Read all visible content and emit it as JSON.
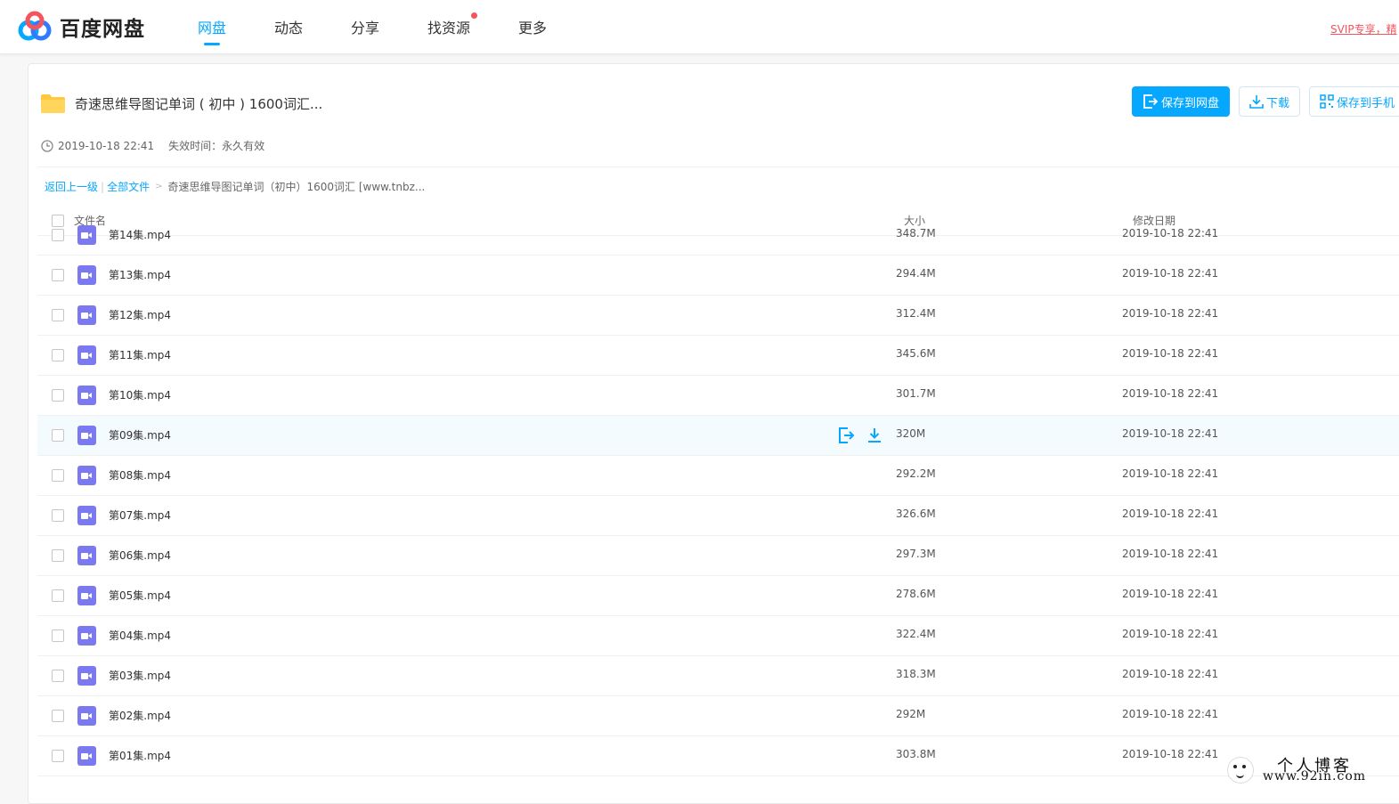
{
  "app": {
    "name": "百度网盘"
  },
  "nav": {
    "items": [
      {
        "label": "网盘",
        "active": true
      },
      {
        "label": "动态",
        "active": false
      },
      {
        "label": "分享",
        "active": false
      },
      {
        "label": "找资源",
        "active": false,
        "badge": true
      },
      {
        "label": "更多",
        "active": false
      }
    ],
    "svip_link": "SVIP专享，精"
  },
  "share": {
    "title": "奇速思维导图记单词 ( 初中 ) 1600词汇...",
    "created": "2019-10-18 22:41",
    "expire_label": "失效时间：",
    "expire_value": "永久有效",
    "folder_icon": "folder-icon",
    "actions": {
      "save_label": "保存到网盘",
      "download_label": "下载",
      "save_phone_label": "保存到手机"
    }
  },
  "breadcrumb": {
    "back": "返回上一级",
    "all": "全部文件",
    "current": "奇速思维导图记单词（初中）1600词汇 [www.tnbz..."
  },
  "table": {
    "headers": {
      "name": "文件名",
      "size": "大小",
      "date": "修改日期"
    },
    "rows": [
      {
        "name": "第14集.mp4",
        "size": "348.7M",
        "date": "2019-10-18 22:41"
      },
      {
        "name": "第13集.mp4",
        "size": "294.4M",
        "date": "2019-10-18 22:41"
      },
      {
        "name": "第12集.mp4",
        "size": "312.4M",
        "date": "2019-10-18 22:41"
      },
      {
        "name": "第11集.mp4",
        "size": "345.6M",
        "date": "2019-10-18 22:41"
      },
      {
        "name": "第10集.mp4",
        "size": "301.7M",
        "date": "2019-10-18 22:41"
      },
      {
        "name": "第09集.mp4",
        "size": "320M",
        "date": "2019-10-18 22:41",
        "hover": true
      },
      {
        "name": "第08集.mp4",
        "size": "292.2M",
        "date": "2019-10-18 22:41"
      },
      {
        "name": "第07集.mp4",
        "size": "326.6M",
        "date": "2019-10-18 22:41"
      },
      {
        "name": "第06集.mp4",
        "size": "297.3M",
        "date": "2019-10-18 22:41"
      },
      {
        "name": "第05集.mp4",
        "size": "278.6M",
        "date": "2019-10-18 22:41"
      },
      {
        "name": "第04集.mp4",
        "size": "322.4M",
        "date": "2019-10-18 22:41"
      },
      {
        "name": "第03集.mp4",
        "size": "318.3M",
        "date": "2019-10-18 22:41"
      },
      {
        "name": "第02集.mp4",
        "size": "292M",
        "date": "2019-10-18 22:41"
      },
      {
        "name": "第01集.mp4",
        "size": "303.8M",
        "date": "2019-10-18 22:41"
      }
    ]
  },
  "watermark": {
    "title": "个人博客",
    "url": "www.92in.com"
  },
  "colors": {
    "accent": "#06a7ff",
    "video_icon": "#7b79f0",
    "badge": "#f5535e"
  }
}
